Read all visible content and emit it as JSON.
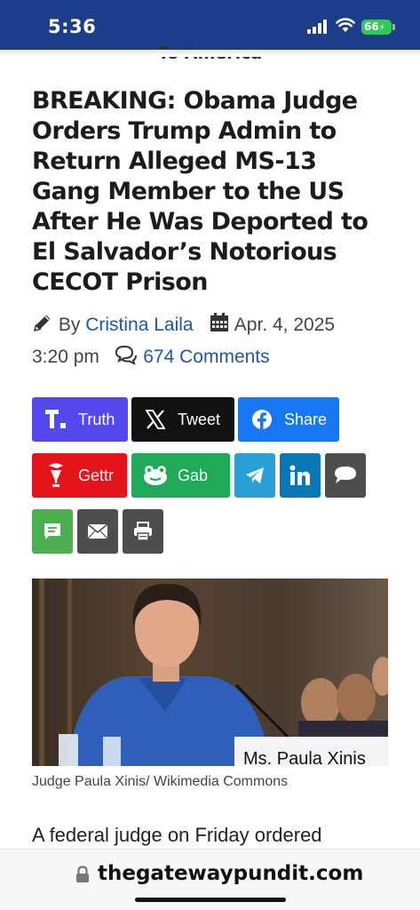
{
  "status_bar": {
    "time": "5:36",
    "battery": "66"
  },
  "site": {
    "tagline": "To America",
    "url": "thegatewaypundit.com"
  },
  "article": {
    "headline": "BREAKING: Obama Judge Orders Trump Admin to Return Alleged MS-13 Gang Member to the US After He Was Deported to El Salvador’s Notorious CECOT Prison",
    "by_label": "By",
    "author": "Cristina Laila",
    "date": "Apr. 4, 2025",
    "time": "3:20 pm",
    "comments": "674 Comments",
    "caption": "Judge Paula Xinis/ Wikimedia Commons",
    "first_line": "A federal judge on Friday ordered",
    "photo_placard": "Ms. Paula Xinis"
  },
  "share": {
    "truth": "Truth",
    "tweet": "Tweet",
    "facebook": "Share",
    "gettr": "Gettr",
    "gab": "Gab"
  },
  "colors": {
    "status_bar": "#1b3d8a",
    "truth": "#5448ee",
    "x": "#111111",
    "facebook": "#1877f2",
    "gettr": "#e3151b",
    "gab": "#21a95a",
    "telegram": "#2b9fd8",
    "linkedin": "#0a78b5",
    "sms": "#4e4e4e",
    "message": "#4caf50",
    "email": "#4e4e4e",
    "print": "#4e4e4e",
    "link": "#1e57a8"
  },
  "icons": [
    "pencil-icon",
    "calendar-icon",
    "comments-icon",
    "truth-icon",
    "x-icon",
    "facebook-icon",
    "gettr-icon",
    "gab-icon",
    "telegram-icon",
    "linkedin-icon",
    "sms-icon",
    "message-icon",
    "email-icon",
    "print-icon",
    "lock-icon"
  ]
}
